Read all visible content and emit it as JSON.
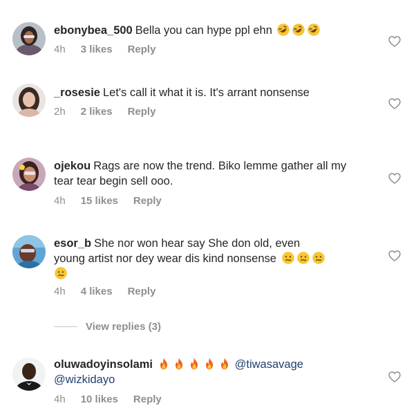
{
  "comments": [
    {
      "username": "ebonybea_500",
      "text": "Bella you can hype ppl ehn",
      "emoji": [
        "rolling-laughing-emoji",
        "rolling-laughing-emoji",
        "rolling-laughing-emoji"
      ],
      "time": "4h",
      "likes": "3 likes",
      "reply": "Reply"
    },
    {
      "username": "_rosesie",
      "text": "Let's call it what it is. It's arrant nonsense",
      "time": "2h",
      "likes": "2 likes",
      "reply": "Reply"
    },
    {
      "username": "ojekou",
      "text": "Rags are now the trend. Biko lemme gather all my tear tear begin sell ooo.",
      "time": "4h",
      "likes": "15 likes",
      "reply": "Reply"
    },
    {
      "username": "esor_b",
      "text_line1": "She nor won hear say She don old, even",
      "text_line2": "young artist nor dey wear dis kind nonsense",
      "emoji": [
        "confused-face-emoji",
        "confused-face-emoji",
        "confused-face-emoji",
        "confused-face-emoji"
      ],
      "time": "4h",
      "likes": "4 likes",
      "reply": "Reply",
      "view_replies": "View replies (3)"
    },
    {
      "username": "oluwadoyinsolami",
      "emoji": [
        "fire-emoji",
        "fire-emoji",
        "fire-emoji",
        "fire-emoji",
        "fire-emoji"
      ],
      "mention1": "@tiwasavage",
      "mention2": "@wizkidayo",
      "time": "4h",
      "likes": "10 likes",
      "reply": "Reply"
    }
  ],
  "colors": {
    "text": "#262626",
    "meta": "#8e8e8e",
    "mention": "#1f3f6f",
    "heart_stroke": "#8e8e8e"
  },
  "icons": {
    "like": "heart-outline-icon"
  }
}
